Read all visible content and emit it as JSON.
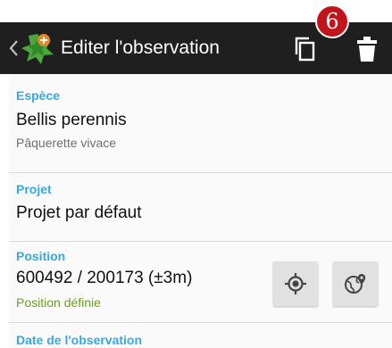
{
  "appbar": {
    "title": "Editer l'observation",
    "badge_count": "6",
    "icons": [
      "chevron-left-icon",
      "app-logo-icon",
      "copy-icon",
      "trash-icon"
    ]
  },
  "species": {
    "label": "Espèce",
    "scientific_name": "Bellis perennis",
    "common_name": "Pâquerette vivace"
  },
  "project": {
    "label": "Projet",
    "value": "Projet par défaut"
  },
  "position": {
    "label": "Position",
    "coordinates": "600492 / 200173 (±3m)",
    "status": "Position définie"
  },
  "date": {
    "label": "Date de l'observation"
  },
  "colors": {
    "appbar": "#1f1f1f",
    "label_blue": "#36a9df",
    "status_green": "#6aa116",
    "badge_red": "#c4141b"
  }
}
